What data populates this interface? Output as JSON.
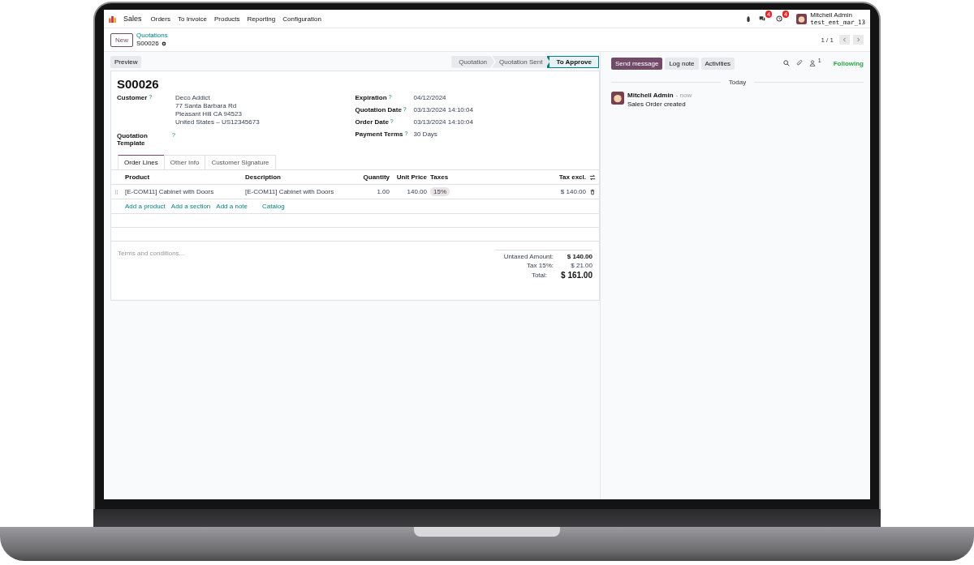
{
  "navbar": {
    "app": "Sales",
    "menus": [
      "Orders",
      "To Invoice",
      "Products",
      "Reporting",
      "Configuration"
    ],
    "message_badge": "4",
    "activity_badge": "4",
    "user": "Mitchell Admin",
    "database": "test_ent_mar_13"
  },
  "control_panel": {
    "new_button": "New",
    "breadcrumb_parent": "Quotations",
    "breadcrumb_current": "S00026",
    "pager": "1 / 1"
  },
  "button_bar": {
    "preview": "Preview",
    "stages": [
      {
        "label": "Quotation",
        "selected": false
      },
      {
        "label": "Quotation Sent",
        "selected": false
      },
      {
        "label": "To Approve",
        "selected": true
      }
    ]
  },
  "form": {
    "title": "S00026",
    "left_fields": [
      {
        "label": "Customer",
        "hint": "?",
        "lines": [
          "Deco Addict",
          "77 Santa Barbara Rd",
          "Pleasant Hill CA 94523",
          "United States – US12345673"
        ]
      },
      {
        "label": "Quotation Template",
        "hint": "?"
      }
    ],
    "right_fields": [
      {
        "label": "Expiration",
        "hint": "?",
        "value": "04/12/2024"
      },
      {
        "label": "Quotation Date",
        "hint": "?",
        "value": "03/13/2024 14:10:04"
      },
      {
        "label": "Order Date",
        "hint": "?",
        "value": "03/13/2024 14:10:04"
      },
      {
        "label": "Payment Terms",
        "hint": "?",
        "value": "30 Days"
      }
    ],
    "tabs": [
      {
        "label": "Order Lines",
        "selected": true
      },
      {
        "label": "Other Info",
        "selected": false
      },
      {
        "label": "Customer Signature",
        "selected": false
      }
    ],
    "table": {
      "columns": [
        "Product",
        "Description",
        "Quantity",
        "Unit Price",
        "Taxes",
        "Tax excl."
      ],
      "rows": [
        {
          "product": "[E-COM11] Cabinet with Doors",
          "description": "[E-COM11] Cabinet with Doors",
          "quantity": "1.00",
          "unit_price": "140.00",
          "taxes": "15%",
          "tax_excl": "$ 140.00"
        }
      ],
      "add_links": [
        "Add a product",
        "Add a section",
        "Add a note",
        "Catalog"
      ]
    },
    "terms_placeholder": "Terms and conditions...",
    "totals": [
      {
        "label": "Untaxed Amount:",
        "value": "$ 140.00",
        "kind": "subtotal"
      },
      {
        "label": "Tax 15%:",
        "value": "$ 21.00",
        "kind": "tax"
      },
      {
        "label": "Total:",
        "value": "$ 161.00",
        "kind": "total"
      }
    ]
  },
  "chatter": {
    "buttons": [
      "Send message",
      "Log note",
      "Activities"
    ],
    "follower_count": "1",
    "following": "Following",
    "date_separator": "Today",
    "messages": [
      {
        "author": "Mitchell Admin",
        "time": "- now",
        "body": "Sales Order created"
      }
    ]
  }
}
